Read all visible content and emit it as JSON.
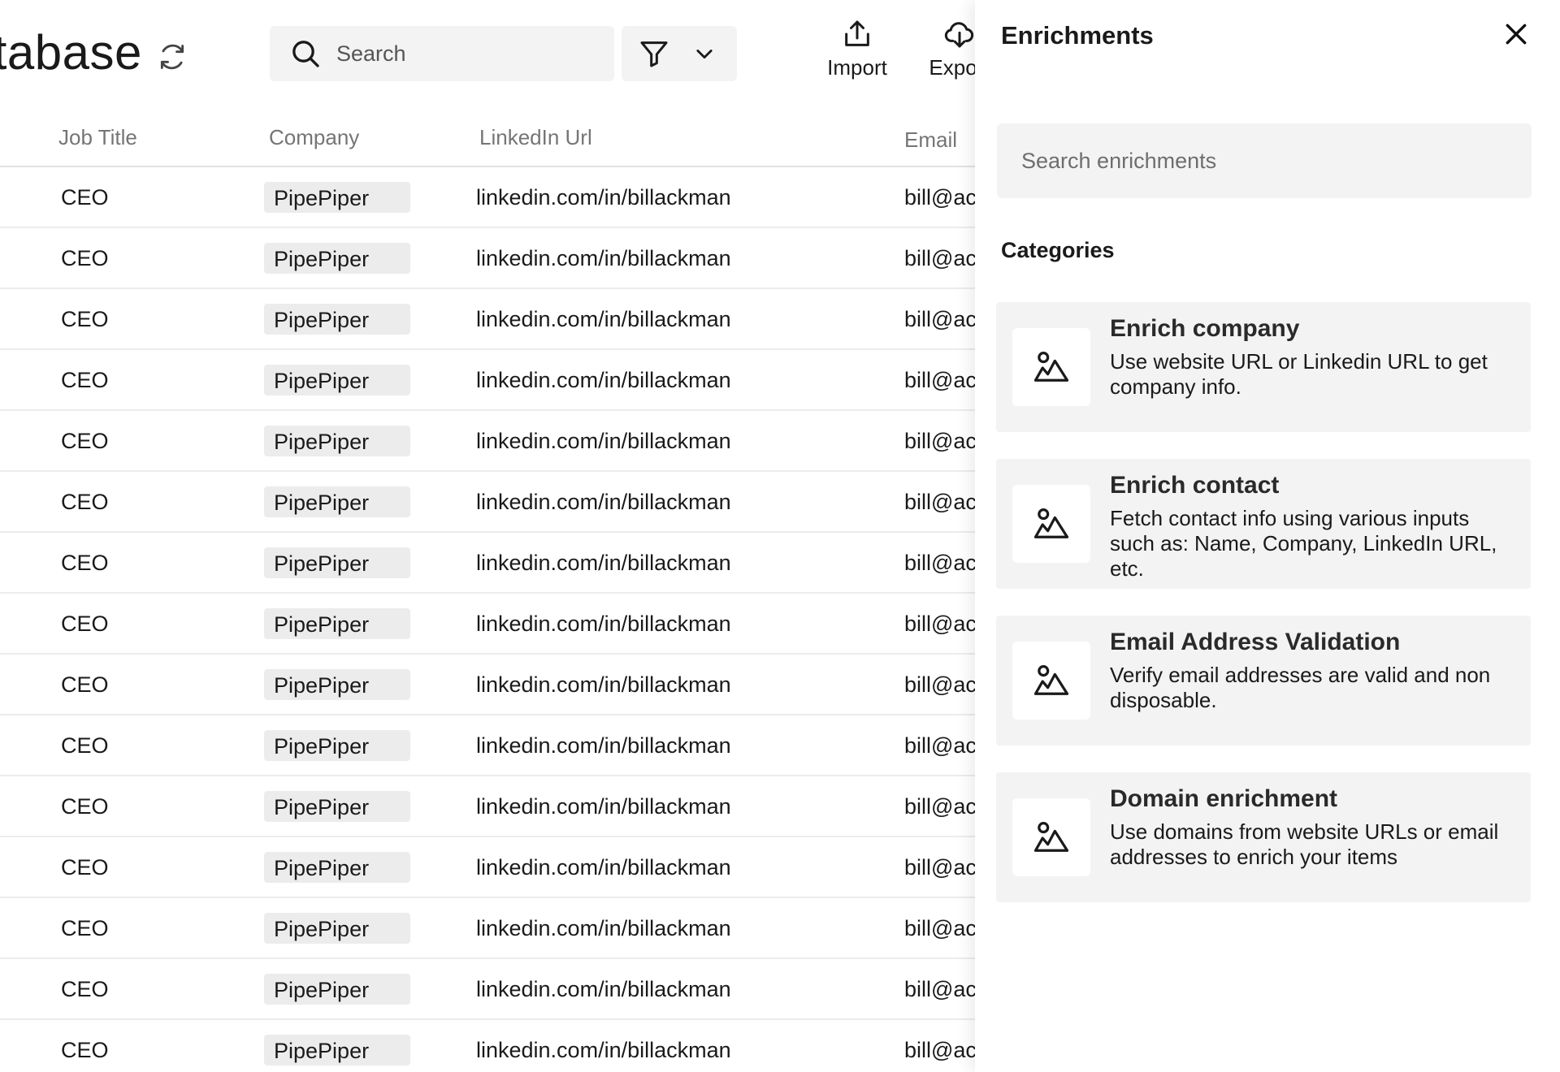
{
  "header": {
    "title": "Database",
    "search_placeholder": "Search",
    "import_label": "Import",
    "export_label": "Export"
  },
  "table": {
    "columns": [
      "Job Title",
      "Company",
      "LinkedIn Url",
      "Email"
    ],
    "rows": [
      {
        "job": "CEO",
        "company": "PipePiper",
        "linkedin": "linkedin.com/in/billackman",
        "email": "bill@ac"
      },
      {
        "job": "CEO",
        "company": "PipePiper",
        "linkedin": "linkedin.com/in/billackman",
        "email": "bill@ac"
      },
      {
        "job": "CEO",
        "company": "PipePiper",
        "linkedin": "linkedin.com/in/billackman",
        "email": "bill@ac"
      },
      {
        "job": "CEO",
        "company": "PipePiper",
        "linkedin": "linkedin.com/in/billackman",
        "email": "bill@ac"
      },
      {
        "job": "CEO",
        "company": "PipePiper",
        "linkedin": "linkedin.com/in/billackman",
        "email": "bill@ac"
      },
      {
        "job": "CEO",
        "company": "PipePiper",
        "linkedin": "linkedin.com/in/billackman",
        "email": "bill@ac"
      },
      {
        "job": "CEO",
        "company": "PipePiper",
        "linkedin": "linkedin.com/in/billackman",
        "email": "bill@ac"
      },
      {
        "job": "CEO",
        "company": "PipePiper",
        "linkedin": "linkedin.com/in/billackman",
        "email": "bill@ac"
      },
      {
        "job": "CEO",
        "company": "PipePiper",
        "linkedin": "linkedin.com/in/billackman",
        "email": "bill@ac"
      },
      {
        "job": "CEO",
        "company": "PipePiper",
        "linkedin": "linkedin.com/in/billackman",
        "email": "bill@ac"
      },
      {
        "job": "CEO",
        "company": "PipePiper",
        "linkedin": "linkedin.com/in/billackman",
        "email": "bill@ac"
      },
      {
        "job": "CEO",
        "company": "PipePiper",
        "linkedin": "linkedin.com/in/billackman",
        "email": "bill@ac"
      },
      {
        "job": "CEO",
        "company": "PipePiper",
        "linkedin": "linkedin.com/in/billackman",
        "email": "bill@ac"
      },
      {
        "job": "CEO",
        "company": "PipePiper",
        "linkedin": "linkedin.com/in/billackman",
        "email": "bill@ac"
      },
      {
        "job": "CEO",
        "company": "PipePiper",
        "linkedin": "linkedin.com/in/billackman",
        "email": "bill@ac"
      }
    ]
  },
  "panel": {
    "title": "Enrichments",
    "search_placeholder": "Search enrichments",
    "categories_title": "Categories",
    "cards": [
      {
        "title": "Enrich company",
        "description": "Use website URL or Linkedin URL to get company info.",
        "icon": "person-icon"
      },
      {
        "title": "Enrich contact",
        "description": "Fetch contact info using various inputs such as: Name, Company, LinkedIn URL, etc.",
        "icon": "person-icon"
      },
      {
        "title": "Email Address Validation",
        "description": "Verify email addresses are valid and non disposable.",
        "icon": "person-icon"
      },
      {
        "title": "Domain enrichment",
        "description": "Use domains from website URLs or email addresses to enrich your items",
        "icon": "person-icon"
      }
    ]
  }
}
